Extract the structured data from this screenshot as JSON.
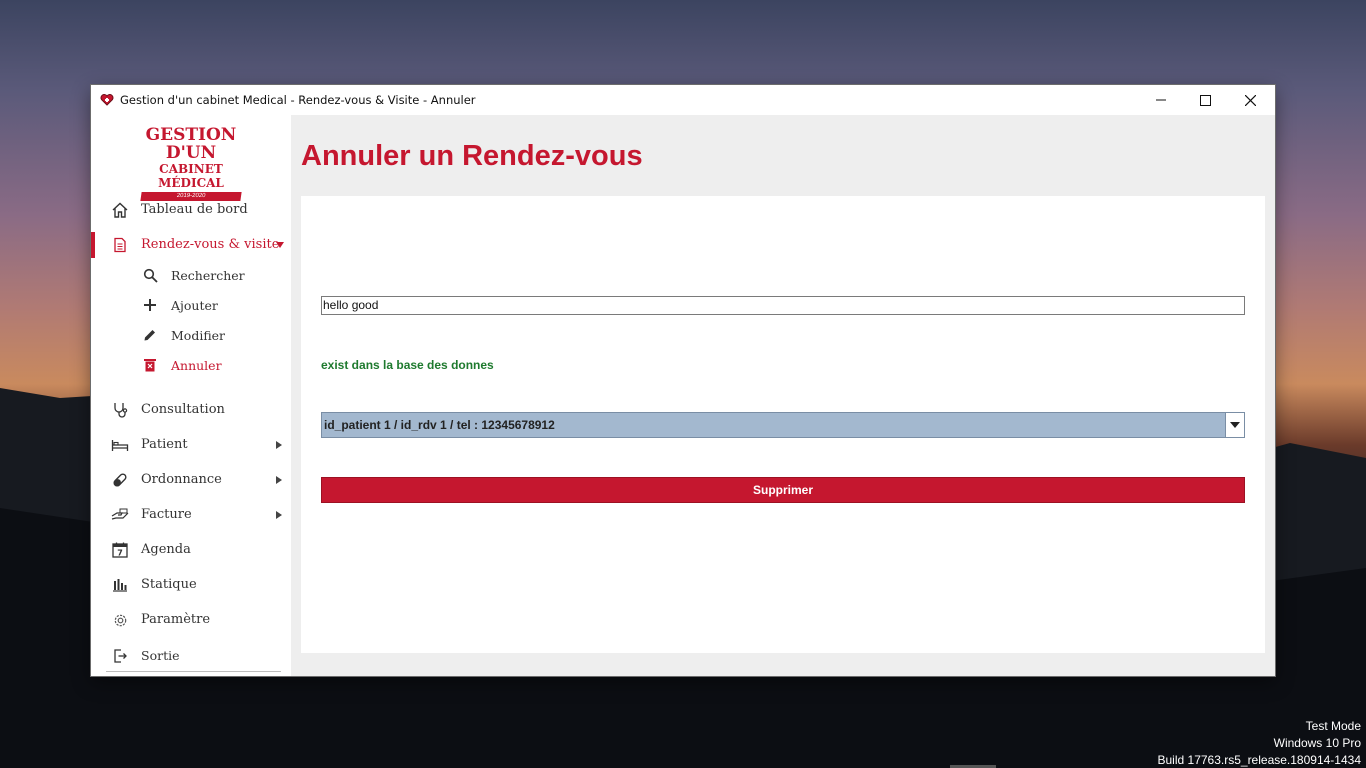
{
  "window": {
    "title": "Gestion d'un cabinet Medical - Rendez-vous & Visite - Annuler"
  },
  "logo": {
    "line1": "GESTION D'UN",
    "line2": "CABINET MÉDICAL",
    "line3": "2019-2020"
  },
  "sidebar": {
    "items": [
      {
        "label": "Tableau de bord",
        "icon": "home-icon"
      },
      {
        "label": "Rendez-vous & visite",
        "icon": "document-icon",
        "active": true
      },
      {
        "label": "Consultation",
        "icon": "stethoscope-icon"
      },
      {
        "label": "Patient",
        "icon": "bed-icon"
      },
      {
        "label": "Ordonnance",
        "icon": "pill-icon"
      },
      {
        "label": "Facture",
        "icon": "hand-money-icon"
      },
      {
        "label": "Agenda",
        "icon": "calendar-icon"
      },
      {
        "label": "Statique",
        "icon": "bar-chart-icon"
      },
      {
        "label": "Paramètre",
        "icon": "gear-icon"
      }
    ],
    "sub_items": [
      {
        "label": "Rechercher",
        "icon": "search-icon"
      },
      {
        "label": "Ajouter",
        "icon": "plus-icon"
      },
      {
        "label": "Modifier",
        "icon": "pencil-icon"
      },
      {
        "label": "Annuler",
        "icon": "trash-icon",
        "active": true
      }
    ],
    "exit": {
      "label": "Sortie",
      "icon": "exit-icon"
    }
  },
  "main": {
    "title": "Annuler un Rendez-vous",
    "search_value": "hello good",
    "status_text": "exist dans la base des donnes",
    "status_color": "#1e7a2e",
    "select_value": "id_patient 1 / id_rdv 1 / tel : 12345678912",
    "delete_label": "Supprimer"
  },
  "colors": {
    "accent": "#c5172f",
    "select_bg": "#a3b8cf"
  },
  "desktop": {
    "watermark": [
      "Test Mode",
      "Windows 10 Pro",
      "Build 17763.rs5_release.180914-1434"
    ]
  }
}
